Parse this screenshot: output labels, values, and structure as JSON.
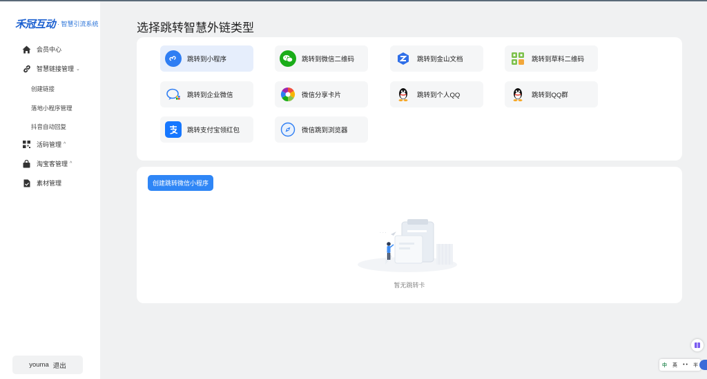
{
  "brand": {
    "name": "禾冠互动",
    "subtitle": "· 智慧引流系统"
  },
  "sidebar": {
    "items": [
      {
        "label": "会员中心",
        "icon": "home-icon"
      },
      {
        "label": "智慧链接管理",
        "icon": "link-icon",
        "caret": "⌄"
      },
      {
        "label": "活码管理",
        "icon": "qrcode-icon",
        "caret": "^"
      },
      {
        "label": "淘宝客管理",
        "icon": "bag-icon",
        "caret": "^"
      },
      {
        "label": "素材管理",
        "icon": "file-icon"
      }
    ],
    "subitems": [
      "创建链接",
      "落地小程序管理",
      "抖音自动回复"
    ]
  },
  "user": {
    "name": "youma",
    "logout": "退出"
  },
  "page": {
    "title": "选择跳转智慧外链类型"
  },
  "options": [
    {
      "label": "跳转到小程序",
      "icon": "miniprogram-icon",
      "active": true
    },
    {
      "label": "跳转到微信二维码",
      "icon": "wechat-icon"
    },
    {
      "label": "跳转到金山文档",
      "icon": "kdocs-icon"
    },
    {
      "label": "跳转到草料二维码",
      "icon": "caoliao-qrcode-icon"
    },
    {
      "label": "跳转到企业微信",
      "icon": "wecom-icon"
    },
    {
      "label": "微信分享卡片",
      "icon": "share-card-icon"
    },
    {
      "label": "跳转到个人QQ",
      "icon": "qq-icon"
    },
    {
      "label": "跳转到QQ群",
      "icon": "qq-group-icon"
    },
    {
      "label": "跳转支付宝领红包",
      "icon": "alipay-icon"
    },
    {
      "label": "微信跳到浏览器",
      "icon": "browser-icon"
    }
  ],
  "list": {
    "create_button": "创建跳转微信小程序",
    "empty_text": "暂无跳转卡"
  },
  "ime": {
    "lang": "英",
    "dots": "• •",
    "width": "半"
  },
  "colors": {
    "primary": "#2f86f6",
    "active_bg": "#e6eefc",
    "brand": "#1a5fd0"
  }
}
